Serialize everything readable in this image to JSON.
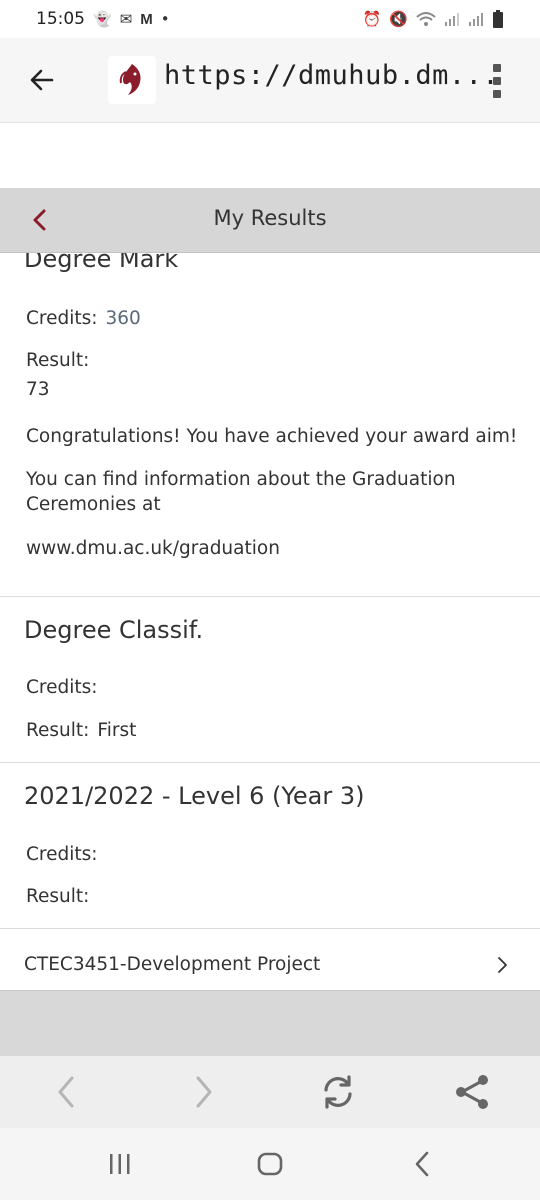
{
  "status_bar": {
    "time": "15:05",
    "left_icons": [
      "snapchat-icon",
      "mail-icon",
      "gmail-icon",
      "dot-icon"
    ],
    "right_icons": [
      "alarm-icon",
      "mute-icon",
      "wifi-icon",
      "signal-icon",
      "signal-icon",
      "battery-icon"
    ]
  },
  "browser": {
    "url": "https://dmuhub.dm...",
    "back_icon": "arrow-left-icon",
    "menu_icon": "kebab-menu-icon"
  },
  "page": {
    "title": "My Results"
  },
  "sections": {
    "degree_mark": {
      "heading": "Degree Mark",
      "credits_label": "Credits:",
      "credits_value": "360",
      "result_label": "Result:",
      "result_value": "73",
      "message": "Congratulations! You have achieved your award aim!",
      "info_line1": "You can find information about the Graduation",
      "info_line2": "Ceremonies at",
      "link": "www.dmu.ac.uk/graduation"
    },
    "degree_classif": {
      "heading": "Degree Classif.",
      "credits_label": "Credits:",
      "result_label": "Result:",
      "result_value": "First"
    },
    "level6": {
      "heading": "2021/2022 - Level 6 (Year 3)",
      "credits_label": "Credits:",
      "result_label": "Result:"
    },
    "modules": [
      {
        "label": "CTEC3451-Development Project"
      }
    ]
  },
  "colors": {
    "accent": "#8a1c2b",
    "titlebar_bg": "#d6d6d6",
    "value_blue_grey": "#5a6a7a"
  }
}
